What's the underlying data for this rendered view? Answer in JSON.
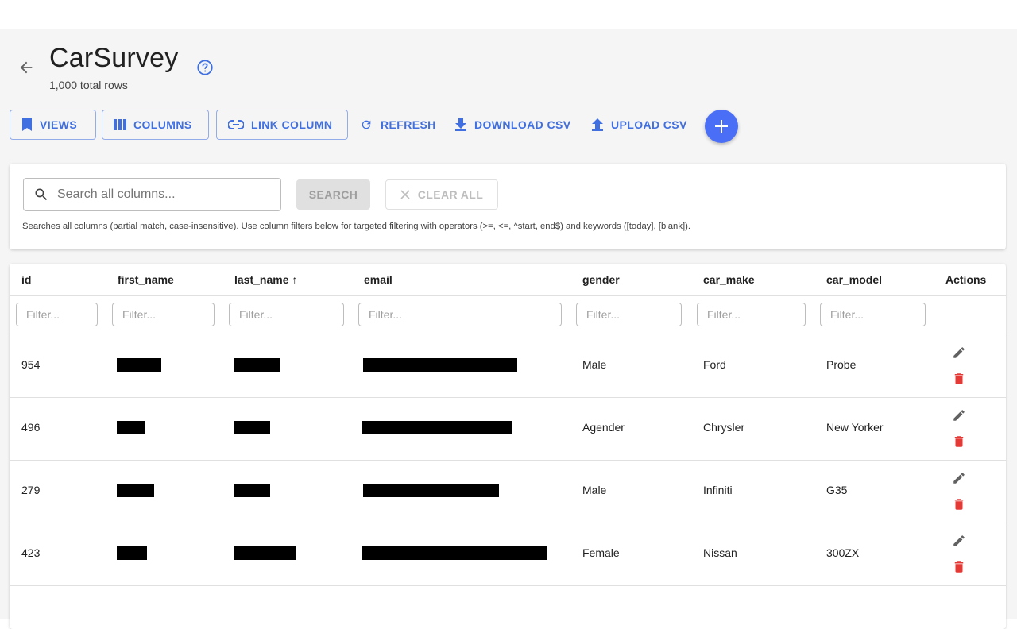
{
  "header": {
    "title": "CarSurvey",
    "row_count": "1,000 total rows",
    "back_icon": "arrow-left-icon",
    "help_icon": "help-circle-icon"
  },
  "toolbar": {
    "views": "VIEWS",
    "columns": "COLUMNS",
    "link_column": "LINK COLUMN",
    "refresh": "REFRESH",
    "download_csv": "DOWNLOAD CSV",
    "upload_csv": "UPLOAD CSV",
    "accent_color": "#3f6fe0",
    "fab_color": "#4a6ef5"
  },
  "search": {
    "placeholder": "Search all columns...",
    "search_button": "SEARCH",
    "clear_button": "CLEAR ALL",
    "hint": "Searches all columns (partial match, case-insensitive). Use column filters below for targeted filtering with operators (>=, <=, ^start, end$) and keywords ([today], [blank])."
  },
  "table": {
    "columns": [
      "id",
      "first_name",
      "last_name ↑",
      "email",
      "gender",
      "car_make",
      "car_model",
      "Actions"
    ],
    "filter_placeholder": "Filter...",
    "rows": [
      {
        "id": "954",
        "gender": "Male",
        "car_make": "Ford",
        "car_model": "Probe"
      },
      {
        "id": "496",
        "gender": "Agender",
        "car_make": "Chrysler",
        "car_model": "New Yorker"
      },
      {
        "id": "279",
        "gender": "Male",
        "car_make": "Infiniti",
        "car_model": "G35"
      },
      {
        "id": "423",
        "gender": "Female",
        "car_make": "Nissan",
        "car_model": "300ZX"
      }
    ],
    "delete_color": "#e53935"
  }
}
